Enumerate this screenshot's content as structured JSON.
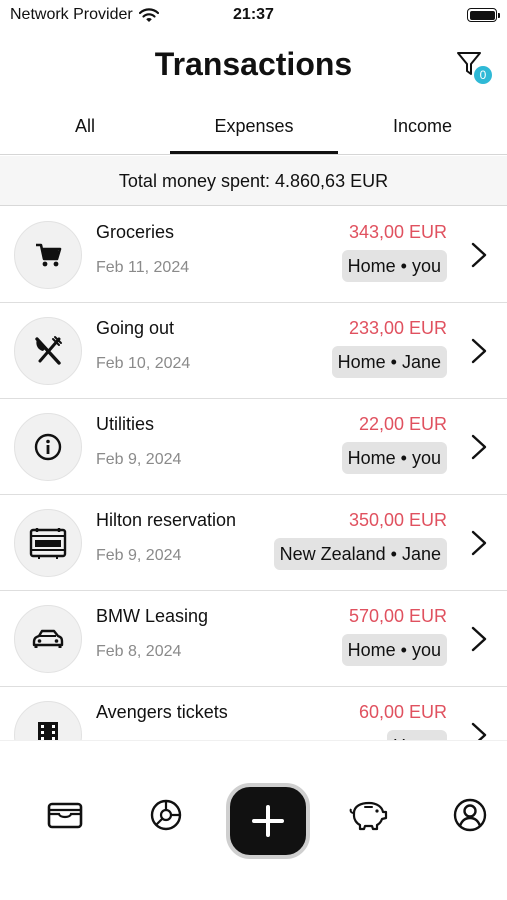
{
  "status_bar": {
    "carrier": "Network Provider",
    "time": "21:37"
  },
  "header": {
    "title": "Transactions",
    "filter_badge": "0"
  },
  "tabs": [
    {
      "label": "All",
      "selected": false
    },
    {
      "label": "Expenses",
      "selected": true
    },
    {
      "label": "Income",
      "selected": false
    }
  ],
  "summary": {
    "text": "Total money spent: 4.860,63 EUR"
  },
  "colors": {
    "amount": "#e0515f",
    "badge": "#2fb9d6",
    "tag_bg": "#e3e3e3",
    "date": "#8a8a8a"
  },
  "transactions": [
    {
      "title": "Groceries",
      "date": "Feb 11, 2024",
      "amount": "343,00 EUR",
      "tag": "Home • you",
      "icon": "cart-icon"
    },
    {
      "title": "Going out",
      "date": "Feb 10, 2024",
      "amount": "233,00 EUR",
      "tag": "Home • Jane",
      "icon": "fork-knife-icon"
    },
    {
      "title": "Utilities",
      "date": "Feb 9, 2024",
      "amount": "22,00 EUR",
      "tag": "Home • you",
      "icon": "info-icon"
    },
    {
      "title": "Hilton reservation",
      "date": "Feb 9, 2024",
      "amount": "350,00 EUR",
      "tag": "New Zealand • Jane",
      "icon": "hotel-icon"
    },
    {
      "title": "BMW Leasing",
      "date": "Feb 8, 2024",
      "amount": "570,00 EUR",
      "tag": "Home • you",
      "icon": "car-icon"
    },
    {
      "title": "Avengers tickets",
      "date": "",
      "amount": "60,00 EUR",
      "tag": "Home",
      "icon": "film-icon"
    }
  ],
  "tabbar": {
    "items": [
      "wallet-icon",
      "chart-pie-icon",
      "plus-icon",
      "piggy-bank-icon",
      "profile-icon"
    ]
  }
}
